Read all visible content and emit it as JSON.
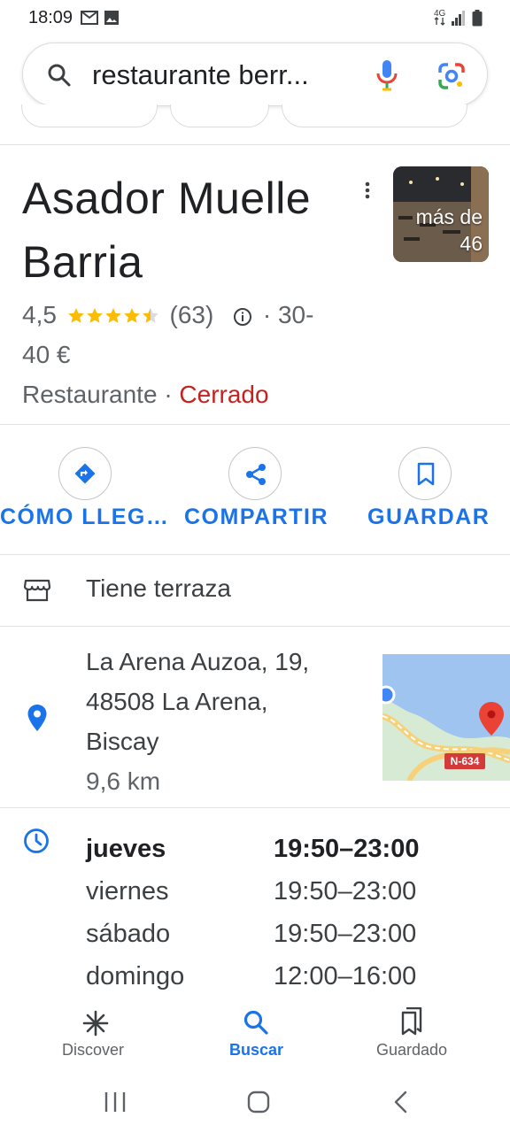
{
  "status_bar": {
    "time": "18:09",
    "network": "4G",
    "icons": [
      "gmail-icon",
      "gallery-icon",
      "signal-icon",
      "battery-icon"
    ]
  },
  "search": {
    "query": "restaurante berr...",
    "icons": [
      "search-icon",
      "mic-icon",
      "lens-icon"
    ]
  },
  "place": {
    "title": "Asador Muelle Barria",
    "photos_label": "más de 46",
    "rating": "4,5",
    "stars": 4.5,
    "reviews": "(63)",
    "price": "· 30-",
    "price_cont": "40 €",
    "category": "Restaurante ·",
    "status": "Cerrado"
  },
  "actions": [
    {
      "label": "CÓMO LLEG…",
      "icon": "directions-icon"
    },
    {
      "label": "COMPARTIR",
      "icon": "share-icon"
    },
    {
      "label": "GUARDAR",
      "icon": "bookmark-icon"
    }
  ],
  "amenity": {
    "icon": "storefront-icon",
    "label": "Tiene terraza"
  },
  "address": {
    "line1": "La Arena Auzoa, 19,",
    "line2": "48508 La Arena,",
    "line3": "Biscay",
    "distance": "9,6 km",
    "map_road": "N-634"
  },
  "hours": [
    {
      "day": "jueves",
      "time": "19:50–23:00",
      "today": true
    },
    {
      "day": "viernes",
      "time": "19:50–23:00",
      "today": false
    },
    {
      "day": "sábado",
      "time": "19:50–23:00",
      "today": false
    },
    {
      "day": "domingo",
      "time": "12:00–16:00",
      "today": false
    }
  ],
  "bottom_nav": [
    {
      "label": "Discover",
      "icon": "discover-icon",
      "active": false
    },
    {
      "label": "Buscar",
      "icon": "search-icon",
      "active": true
    },
    {
      "label": "Guardado",
      "icon": "saved-icon",
      "active": false
    }
  ],
  "colors": {
    "accent": "#1a73e8",
    "star": "#fbbc04",
    "closed": "#c5221f",
    "text": "#202124",
    "secondary": "#5f6368"
  }
}
